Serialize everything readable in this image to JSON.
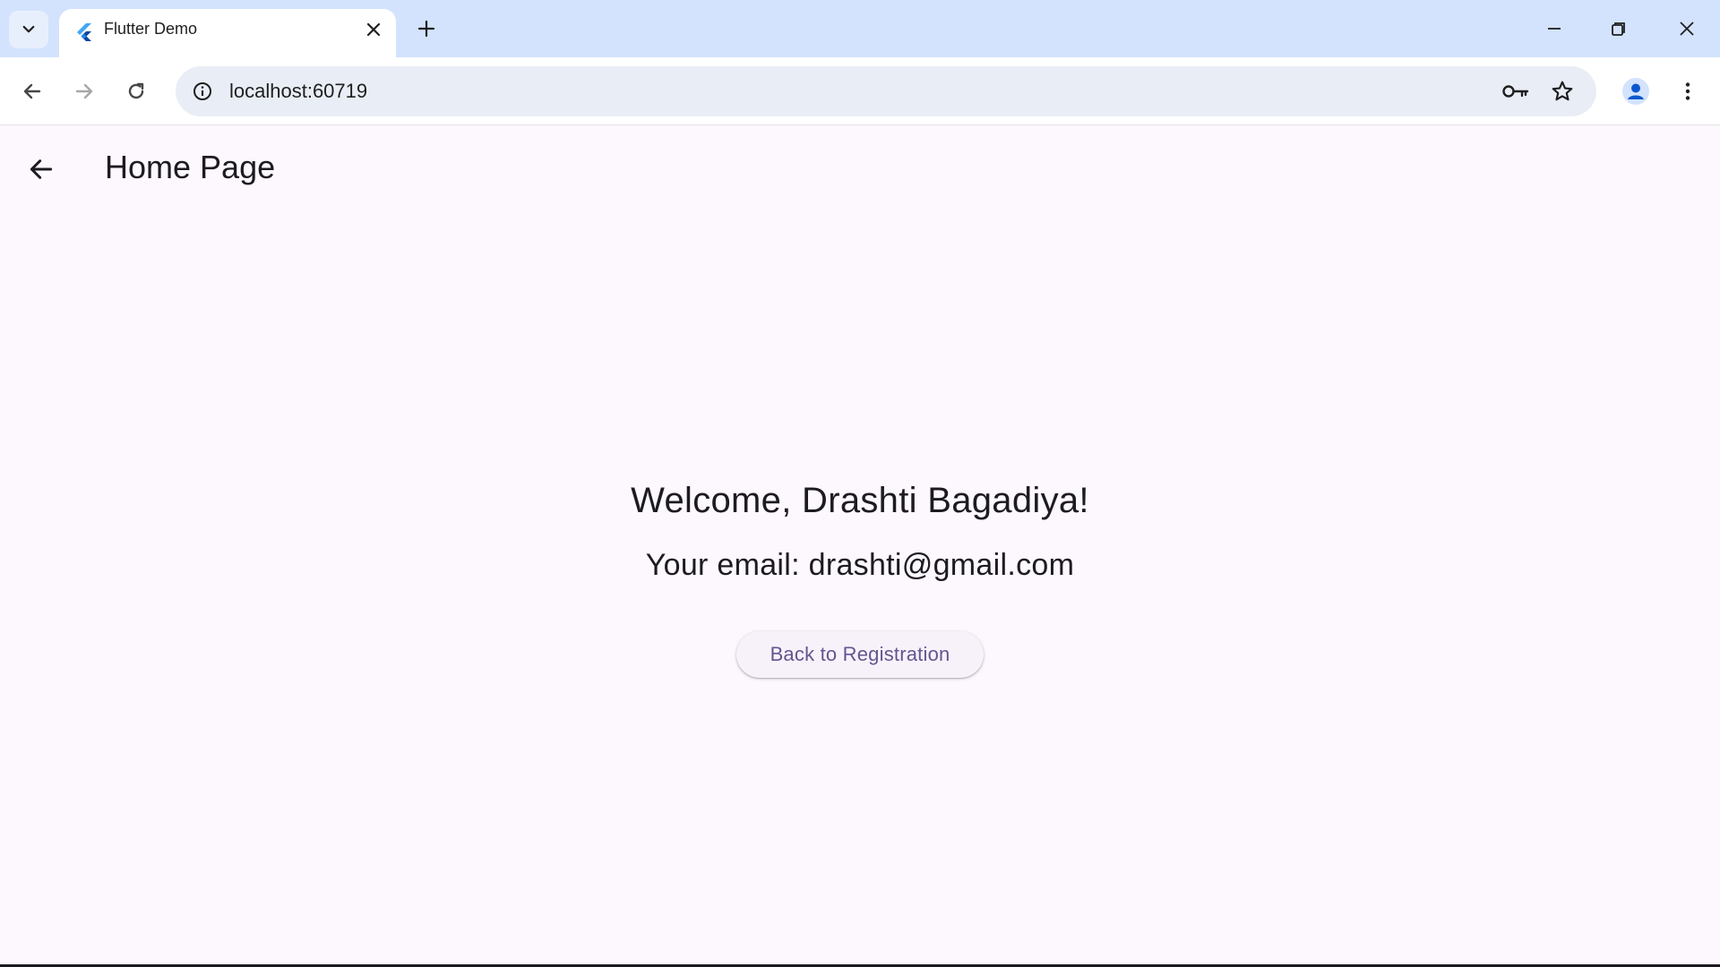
{
  "browser": {
    "tab_title": "Flutter Demo",
    "url": "localhost:60719",
    "icons": {
      "tab_search": "chevron-down-icon",
      "favicon": "flutter-icon",
      "tab_close": "close-icon",
      "new_tab": "plus-icon",
      "minimize": "minimize-icon",
      "restore": "restore-icon",
      "close_window": "close-icon",
      "back": "arrow-left-icon",
      "forward": "arrow-right-icon",
      "reload": "reload-icon",
      "site_info": "info-icon",
      "password": "key-icon",
      "bookmark": "star-icon",
      "profile": "avatar-icon",
      "menu": "kebab-menu-icon"
    }
  },
  "app": {
    "appbar_title": "Home Page",
    "welcome_text": "Welcome, Drashti Bagadiya!",
    "email_text": "Your email: drashti@gmail.com",
    "back_button_label": "Back to Registration"
  },
  "colors": {
    "chrome_bg": "#d3e3fd",
    "app_bg": "#fdf7fe",
    "button_text": "#65558f",
    "text": "#1d1b20"
  }
}
